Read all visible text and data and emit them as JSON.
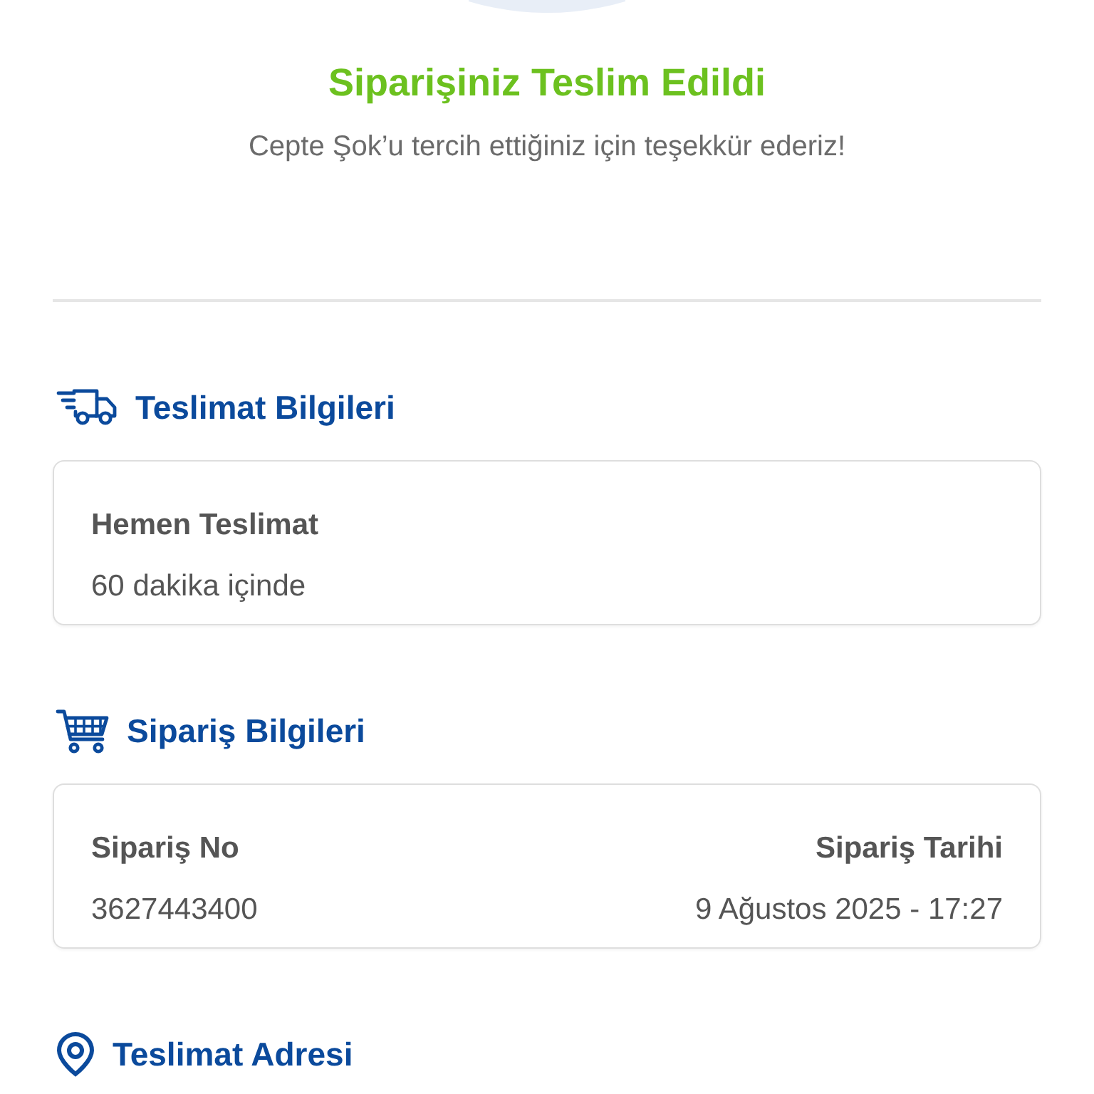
{
  "header": {
    "title": "Siparişiniz Teslim Edildi",
    "subtitle": "Cepte Şok’u tercih ettiğiniz için teşekkür ederiz!"
  },
  "sections": [
    {
      "kind": "truck",
      "title": "Teslimat Bilgileri",
      "card": {
        "columns": [
          {
            "label": "Hemen Teslimat",
            "value": "60 dakika içinde"
          }
        ]
      }
    },
    {
      "kind": "cart",
      "title": "Sipariş Bilgileri",
      "card": {
        "columns": [
          {
            "label": "Sipariş No",
            "value": "3627443400"
          },
          {
            "label": "Sipariş Tarihi",
            "value": "9 Ağustos 2025 - 17:27"
          }
        ]
      }
    },
    {
      "kind": "pin",
      "title": "Teslimat Adresi"
    }
  ]
}
